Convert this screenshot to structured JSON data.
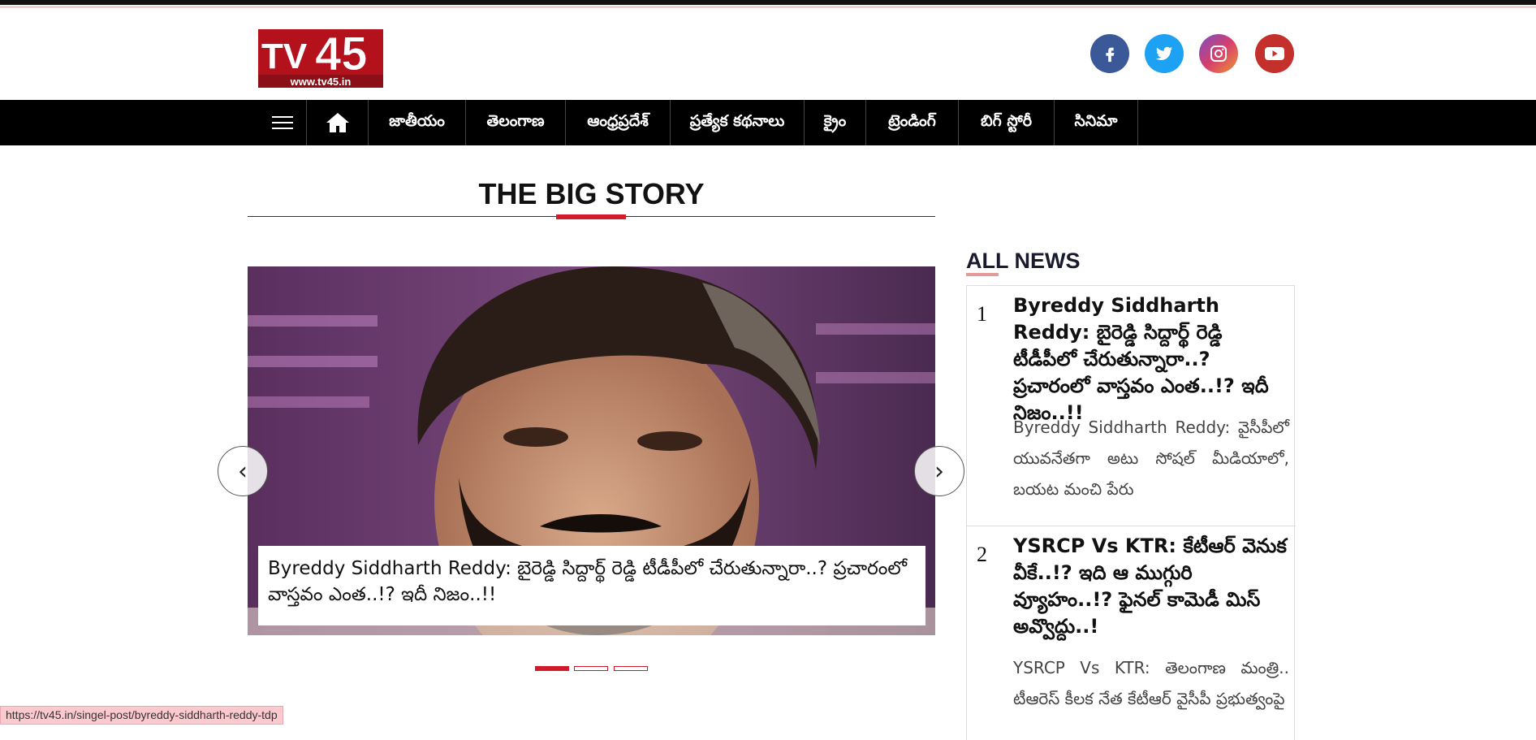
{
  "brand": {
    "logo_text": "TV45",
    "logo_url": "www.tv45.in"
  },
  "social": [
    {
      "name": "facebook",
      "glyph": "f",
      "color": "#3b5998"
    },
    {
      "name": "twitter",
      "glyph": "🐦",
      "color": "#1da1f2"
    },
    {
      "name": "instagram",
      "glyph": "◎",
      "color": "#c13584"
    },
    {
      "name": "youtube",
      "glyph": "▶",
      "color": "#c4302b"
    }
  ],
  "nav": {
    "menu_icon": "hamburger-icon",
    "home_icon": "home-icon",
    "items": [
      "జాతీయం",
      "తెలంగాణ",
      "ఆంధ్రప్రదేశ్",
      "ప్రత్యేక కథనాలు",
      "క్రైం",
      "ట్రెండింగ్",
      "బిగ్ స్టోరీ",
      "సినిమా"
    ]
  },
  "big_story": {
    "title": "THE BIG STORY",
    "caption": "Byreddy Siddharth Reddy: బైరెడ్డి సిద్దార్థ్ రెడ్డి టీడీపీలో చేరుతున్నారా..? ప్రచారంలో వాస్తవం ఎంత..!? ఇదీ నిజం..!!",
    "prev": "‹",
    "next": "›",
    "slides": 3,
    "active_slide": 1
  },
  "all_news": {
    "title": "ALL NEWS",
    "items": [
      {
        "num": "1",
        "title": "Byreddy Siddharth Reddy: బైరెడ్డి సిద్దార్థ్ రెడ్డి టీడీపీలో చేరుతున్నారా..? ప్రచారంలో వాస్తవం ఎంత..!? ఇదీ నిజం..!!",
        "desc": "Byreddy Siddharth Reddy: వైసీపీలో యువనేతగా అటు సోషల్ మీడియాలో, బయట మంచి పేరు"
      },
      {
        "num": "2",
        "title": "YSRCP Vs KTR: కేటీఆర్ వెనుక వీకే..!? ఇది ఆ ముగ్గురి వ్యూహం..!? ఫైనల్ కామెడీ మిస్ అవ్వొద్దు..!",
        "desc": "YSRCP Vs KTR: తెలంగాణ మంత్రి.. టీఆరెస్ కీలక నేత కేటీఆర్ వైసీపీ ప్రభుత్వంపై"
      }
    ]
  },
  "status_bar": {
    "url": "https://tv45.in/singel-post/byreddy-siddharth-reddy-tdp"
  }
}
